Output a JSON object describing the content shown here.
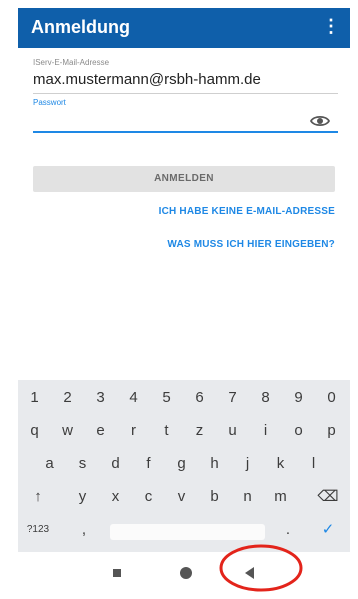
{
  "appbar": {
    "title": "Anmeldung",
    "menu_icon": "⋮"
  },
  "form": {
    "email_label": "IServ-E-Mail-Adresse",
    "email_value": "max.mustermann@rsbh-hamm.de",
    "password_label": "Passwort",
    "password_value": "",
    "login_button": "ANMELDEN",
    "link_no_email": "ICH HABE KEINE E-MAIL-ADRESSE",
    "link_what_to_enter": "WAS MUSS ICH HIER EINGEBEN?"
  },
  "keyboard": {
    "row_numbers": [
      "1",
      "2",
      "3",
      "4",
      "5",
      "6",
      "7",
      "8",
      "9",
      "0"
    ],
    "row_1": [
      "q",
      "w",
      "e",
      "r",
      "t",
      "z",
      "u",
      "i",
      "o",
      "p"
    ],
    "row_2": [
      "a",
      "s",
      "d",
      "f",
      "g",
      "h",
      "j",
      "k",
      "l"
    ],
    "row_3": [
      "y",
      "x",
      "c",
      "v",
      "b",
      "n",
      "m"
    ],
    "shift_icon": "↑",
    "backspace_icon": "⌫",
    "symbols_label": "?123",
    "comma": ",",
    "period": ".",
    "enter_icon": "✓"
  },
  "colors": {
    "appbar": "#0f5faa",
    "accent": "#1e88e5",
    "annotation": "#e3241b"
  }
}
